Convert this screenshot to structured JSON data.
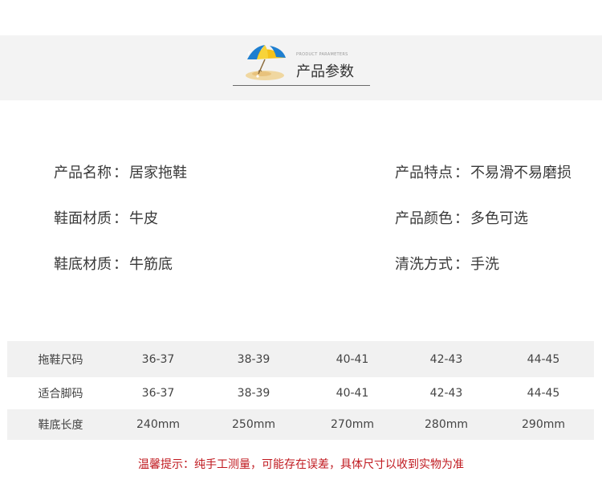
{
  "header": {
    "subtitle_en": "PRODUCT PARAMETERS",
    "title": "产品参数"
  },
  "params": {
    "left": [
      {
        "label": "产品名称",
        "sep": "：",
        "value": "居家拖鞋"
      },
      {
        "label": "鞋面材质",
        "sep": "：",
        "value": "牛皮"
      },
      {
        "label": "鞋底材质",
        "sep": "：",
        "value": "牛筋底"
      }
    ],
    "right": [
      {
        "label": "产品特点",
        "sep": "：",
        "value": "不易滑不易磨损"
      },
      {
        "label": "产品颜色",
        "sep": "：",
        "value": "多色可选"
      },
      {
        "label": "清洗方式",
        "sep": "：",
        "value": "手洗"
      }
    ]
  },
  "size_table": {
    "rows": [
      {
        "label": "拖鞋尺码",
        "cells": [
          "36-37",
          "38-39",
          "40-41",
          "42-43",
          "44-45"
        ]
      },
      {
        "label": "适合脚码",
        "cells": [
          "36-37",
          "38-39",
          "40-41",
          "42-43",
          "44-45"
        ]
      },
      {
        "label": "鞋底长度",
        "cells": [
          "240mm",
          "250mm",
          "270mm",
          "280mm",
          "290mm"
        ]
      }
    ]
  },
  "note": "温馨提示：纯手工测量，可能存在误差，具体尺寸以收到实物为准",
  "colors": {
    "header_band": "#f3f3f3",
    "row_shade": "#f1f1f1",
    "note_red": "#c0191f"
  },
  "icons": {
    "header_logo": "beach-umbrella-icon"
  }
}
